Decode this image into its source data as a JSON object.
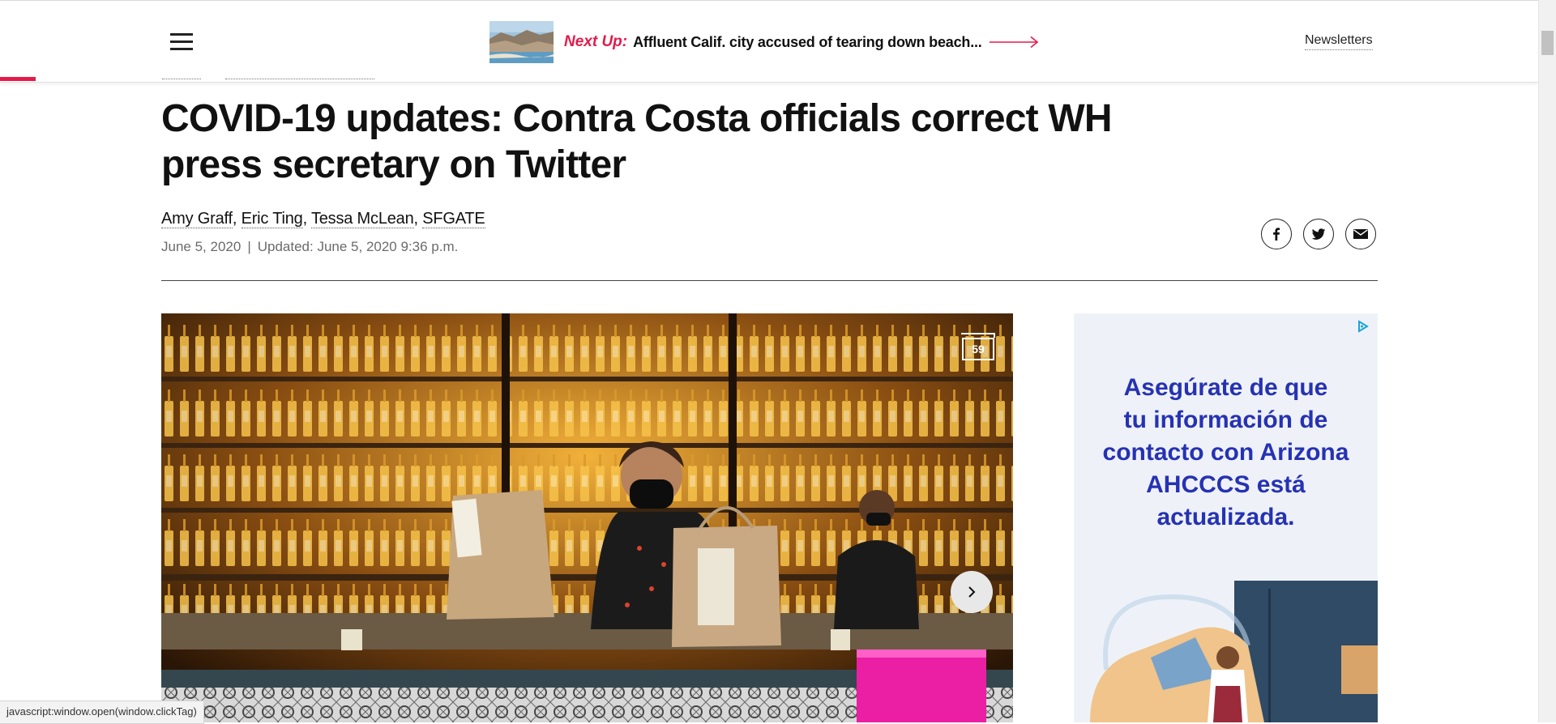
{
  "header": {
    "next_up_label": "Next Up:",
    "next_up_title": "Affluent Calif. city accused of tearing down beach...",
    "newsletters_label": "Newsletters"
  },
  "article": {
    "headline": "COVID-19 updates: Contra Costa officials correct WH press secretary on Twitter",
    "authors": [
      "Amy Graff",
      "Eric Ting",
      "Tessa McLean",
      "SFGATE"
    ],
    "published": "June 5, 2020",
    "separator": "|",
    "updated": "Updated: June 5, 2020 9:36 p.m.",
    "share_icons": [
      "facebook-icon",
      "twitter-icon",
      "email-icon"
    ]
  },
  "gallery": {
    "count": "59"
  },
  "ad": {
    "text_lines": [
      "Asegúrate de que",
      "tu información de",
      "contacto con Arizona",
      "AHCCCS está",
      "actualizada."
    ]
  },
  "status_bar": {
    "text": "javascript:window.open(window.clickTag)"
  },
  "colors": {
    "accent": "#e31b4a",
    "ad_text": "#2632b3"
  }
}
